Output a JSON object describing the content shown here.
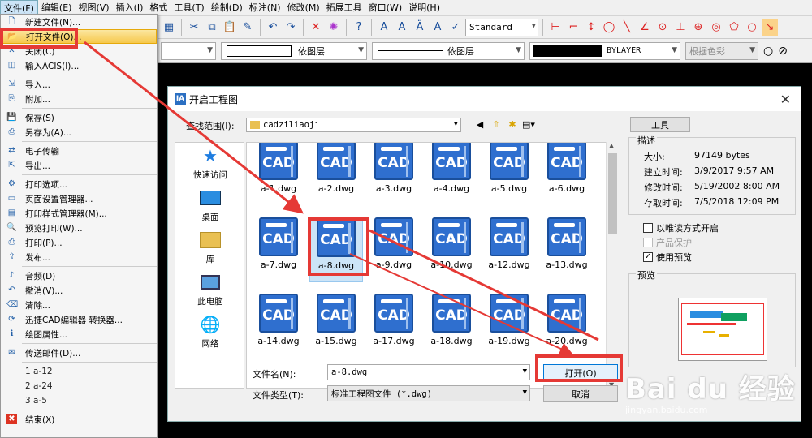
{
  "menubar": [
    "文件(F)",
    "编辑(E)",
    "视图(V)",
    "插入(I)",
    "格式",
    "工具(T)",
    "绘制(D)",
    "标注(N)",
    "修改(M)",
    "拓展工具",
    "窗口(W)",
    "说明(H)"
  ],
  "toolbar": {
    "text_style": "Standard",
    "layer": "依图层",
    "linetype": "依图层",
    "color": "BYLAYER",
    "plotstyle": "根据色彩"
  },
  "file_menu": {
    "items": [
      {
        "label": "新建文件(N)...",
        "icon": "new-file-icon"
      },
      {
        "label": "打开文件(O)...",
        "icon": "open-file-icon"
      },
      {
        "label": "关闭(C)",
        "icon": "close-icon"
      },
      {
        "label": "输入ACIS(I)...",
        "icon": "acis-icon"
      },
      {
        "label": "导入...",
        "icon": "import-icon"
      },
      {
        "label": "附加...",
        "icon": "attach-icon"
      },
      {
        "label": "保存(S)",
        "icon": "save-icon"
      },
      {
        "label": "另存为(A)...",
        "icon": "save-as-icon"
      },
      {
        "label": "电子传输",
        "icon": "etransmit-icon"
      },
      {
        "label": "导出...",
        "icon": "export-icon"
      },
      {
        "label": "打印选项...",
        "icon": "print-options-icon"
      },
      {
        "label": "页面设置管理器...",
        "icon": "page-setup-icon"
      },
      {
        "label": "打印样式管理器(M)...",
        "icon": "plot-style-icon"
      },
      {
        "label": "预览打印(W)...",
        "icon": "print-preview-icon"
      },
      {
        "label": "打印(P)...",
        "icon": "print-icon"
      },
      {
        "label": "发布...",
        "icon": "publish-icon"
      },
      {
        "label": "音频(D)",
        "icon": "audio-icon"
      },
      {
        "label": "撤消(V)...",
        "icon": "undo-icon"
      },
      {
        "label": "清除...",
        "icon": "purge-icon"
      },
      {
        "label": "迅捷CAD编辑器 转换器...",
        "icon": "converter-icon"
      },
      {
        "label": "绘图属性...",
        "icon": "drawing-props-icon"
      },
      {
        "label": "传送邮件(D)...",
        "icon": "mail-icon"
      },
      {
        "label": "1 a-12",
        "icon": ""
      },
      {
        "label": "2 a-24",
        "icon": ""
      },
      {
        "label": "3 a-5",
        "icon": ""
      },
      {
        "label": "结束(X)",
        "icon": "exit-icon"
      }
    ]
  },
  "dialog": {
    "title": "开启工程图",
    "lookin_label": "查找范围(I):",
    "lookin_value": "cadziliaoji",
    "tools_label": "工具",
    "places": [
      "快速访问",
      "桌面",
      "库",
      "此电脑",
      "网络"
    ],
    "files": [
      "a-1.dwg",
      "a-2.dwg",
      "a-3.dwg",
      "a-4.dwg",
      "a-5.dwg",
      "a-6.dwg",
      "a-7.dwg",
      "a-8.dwg",
      "a-9.dwg",
      "a-10.dwg",
      "a-12.dwg",
      "a-13.dwg",
      "a-14.dwg",
      "a-15.dwg",
      "a-17.dwg",
      "a-18.dwg",
      "a-19.dwg",
      "a-20.dwg"
    ],
    "file_icon_text": "CAD",
    "selected_file": "a-8.dwg",
    "filename_label": "文件名(N):",
    "filename_value": "a-8.dwg",
    "filetype_label": "文件类型(T):",
    "filetype_value": "标准工程图文件 (*.dwg)",
    "open_label": "打开(O)",
    "cancel_label": "取消",
    "desc_title": "描述",
    "desc": [
      {
        "k": "大小:",
        "v": "97149 bytes"
      },
      {
        "k": "建立时间:",
        "v": "3/9/2017 9:57 AM"
      },
      {
        "k": "修改时间:",
        "v": "5/19/2002 8:00 AM"
      },
      {
        "k": "存取时间:",
        "v": "7/5/2018 12:09 PM"
      }
    ],
    "readonly_label": "以唯读方式开启",
    "protect_label": "产品保护",
    "use_preview_label": "使用预览",
    "preview_title": "预览"
  },
  "watermark": {
    "logo": "Bai du 经验",
    "url": "jingyan.baidu.com"
  }
}
